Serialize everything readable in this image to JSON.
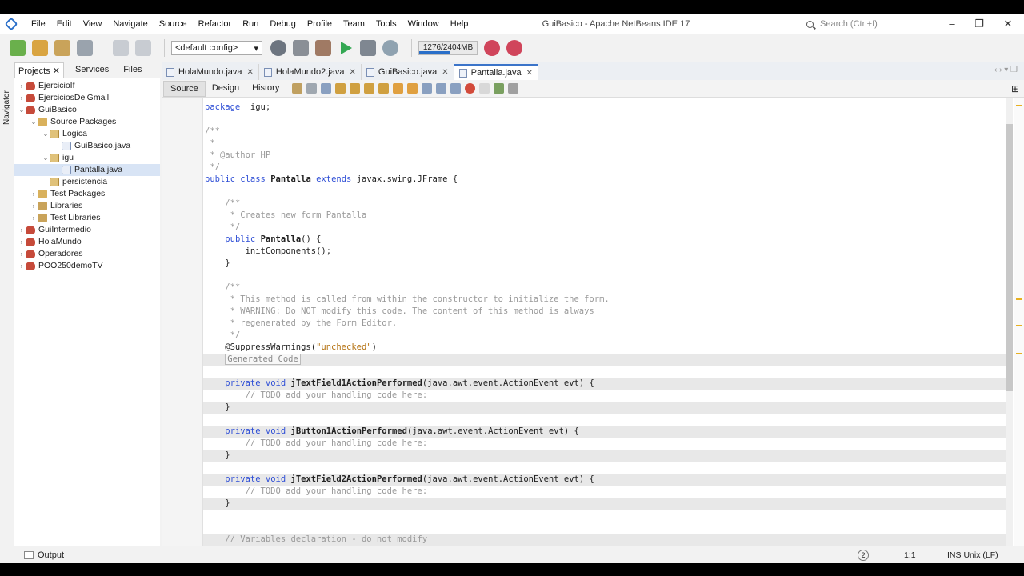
{
  "window": {
    "title": "GuiBasico - Apache NetBeans IDE 17",
    "search_placeholder": "Search (Ctrl+I)"
  },
  "menu": [
    "File",
    "Edit",
    "View",
    "Navigate",
    "Source",
    "Refactor",
    "Run",
    "Debug",
    "Profile",
    "Team",
    "Tools",
    "Window",
    "Help"
  ],
  "toolbar": {
    "config": "<default config>",
    "memory": "1276/2404MB",
    "memory_used_fraction": 0.53
  },
  "projects_panel": {
    "tabs": [
      "Projects",
      "Services",
      "Files"
    ],
    "navigator_label": "Navigator",
    "tree": [
      {
        "label": "EjercicioIf",
        "level": 0,
        "icon": "project-icon",
        "twisty": "collapsed"
      },
      {
        "label": "EjerciciosDelGmail",
        "level": 0,
        "icon": "project-icon",
        "twisty": "collapsed"
      },
      {
        "label": "GuiBasico",
        "level": 0,
        "icon": "project-icon",
        "twisty": "expanded"
      },
      {
        "label": "Source Packages",
        "level": 1,
        "icon": "source-packages-icon",
        "twisty": "expanded"
      },
      {
        "label": "Logica",
        "level": 2,
        "icon": "package-icon",
        "twisty": "expanded"
      },
      {
        "label": "GuiBasico.java",
        "level": 3,
        "icon": "java-file-icon",
        "twisty": ""
      },
      {
        "label": "igu",
        "level": 2,
        "icon": "package-icon",
        "twisty": "expanded"
      },
      {
        "label": "Pantalla.java",
        "level": 3,
        "icon": "java-file-icon",
        "twisty": "",
        "selected": true
      },
      {
        "label": "persistencia",
        "level": 2,
        "icon": "package-icon",
        "twisty": ""
      },
      {
        "label": "Test Packages",
        "level": 1,
        "icon": "source-packages-icon",
        "twisty": "collapsed"
      },
      {
        "label": "Libraries",
        "level": 1,
        "icon": "library-icon",
        "twisty": "collapsed"
      },
      {
        "label": "Test Libraries",
        "level": 1,
        "icon": "library-icon",
        "twisty": "collapsed"
      },
      {
        "label": "GuiIntermedio",
        "level": 0,
        "icon": "project-icon",
        "twisty": "collapsed"
      },
      {
        "label": "HolaMundo",
        "level": 0,
        "icon": "project-icon",
        "twisty": "collapsed"
      },
      {
        "label": "Operadores",
        "level": 0,
        "icon": "project-icon",
        "twisty": "collapsed"
      },
      {
        "label": "POO250demoTV",
        "level": 0,
        "icon": "project-icon",
        "twisty": "collapsed"
      }
    ]
  },
  "editor": {
    "tabs": [
      {
        "label": "HolaMundo.java",
        "active": false
      },
      {
        "label": "HolaMundo2.java",
        "active": false
      },
      {
        "label": "GuiBasico.java",
        "active": false
      },
      {
        "label": "Pantalla.java",
        "active": true
      }
    ],
    "views": [
      "Source",
      "Design",
      "History"
    ],
    "lines": [
      {
        "n": "5",
        "parts": [
          [
            "kw",
            "package"
          ],
          [
            "",
            "  igu;"
          ]
        ]
      },
      {
        "n": "6",
        "parts": []
      },
      {
        "n": "7",
        "fold": "-",
        "parts": [
          [
            "cm",
            "/**"
          ]
        ]
      },
      {
        "n": "8",
        "parts": [
          [
            "cm",
            " *"
          ]
        ]
      },
      {
        "n": "9",
        "parts": [
          [
            "cm",
            " * @author HP"
          ]
        ]
      },
      {
        "n": "10",
        "parts": [
          [
            "cm",
            " */"
          ]
        ]
      },
      {
        "n": "11",
        "parts": [
          [
            "kw",
            "public"
          ],
          [
            "",
            " "
          ],
          [
            "kw",
            "class"
          ],
          [
            "",
            " "
          ],
          [
            "bold",
            "Pantalla"
          ],
          [
            "",
            " "
          ],
          [
            "kw",
            "extends"
          ],
          [
            "",
            " javax.swing.JFrame {"
          ]
        ]
      },
      {
        "n": "12",
        "parts": []
      },
      {
        "n": "13",
        "fold": "-",
        "parts": [
          [
            "",
            "    "
          ],
          [
            "cm",
            "/**"
          ]
        ]
      },
      {
        "n": "14",
        "parts": [
          [
            "cm",
            "     * Creates new form Pantalla"
          ]
        ]
      },
      {
        "n": "15",
        "parts": [
          [
            "cm",
            "     */"
          ]
        ]
      },
      {
        "n": "16",
        "fold": "-",
        "parts": [
          [
            "",
            "    "
          ],
          [
            "kw",
            "public"
          ],
          [
            "",
            " "
          ],
          [
            "bold",
            "Pantalla"
          ],
          [
            "",
            "() {"
          ]
        ]
      },
      {
        "n": "17",
        "parts": [
          [
            "",
            "        initComponents();"
          ]
        ]
      },
      {
        "n": "18",
        "parts": [
          [
            "",
            "    }"
          ]
        ]
      },
      {
        "n": "19",
        "parts": []
      },
      {
        "n": "20",
        "fold": "-",
        "parts": [
          [
            "",
            "    "
          ],
          [
            "cm",
            "/**"
          ]
        ]
      },
      {
        "n": "21",
        "parts": [
          [
            "cm",
            "     * This method is called from within the constructor to initialize the form."
          ]
        ]
      },
      {
        "n": "22",
        "parts": [
          [
            "cm",
            "     * WARNING: Do NOT modify this code. The content of this method is always"
          ]
        ]
      },
      {
        "n": "23",
        "parts": [
          [
            "cm",
            "     * regenerated by the Form Editor."
          ]
        ]
      },
      {
        "n": "24",
        "parts": [
          [
            "cm",
            "     */"
          ]
        ]
      },
      {
        "n": "25",
        "parts": [
          [
            "",
            "    @SuppressWarnings("
          ],
          [
            "str",
            "\"unchecked\""
          ],
          [
            "",
            ")"
          ]
        ]
      },
      {
        "n": "26",
        "fold": "+",
        "guarded": true,
        "parts": [
          [
            "",
            "    "
          ],
          [
            "collapsed",
            "Generated Code"
          ]
        ]
      },
      {
        "n": "104",
        "parts": []
      },
      {
        "n": "105",
        "fold": "-",
        "hint": true,
        "guarded": true,
        "parts": [
          [
            "",
            "    "
          ],
          [
            "kw",
            "private"
          ],
          [
            "",
            " "
          ],
          [
            "kw",
            "void"
          ],
          [
            "",
            " "
          ],
          [
            "bold",
            "jTextField1ActionPerformed"
          ],
          [
            "",
            "(java.awt.event.ActionEvent evt) {"
          ]
        ]
      },
      {
        "n": "106",
        "parts": [
          [
            "cm",
            "        // TODO add your handling code here:"
          ]
        ]
      },
      {
        "n": "107",
        "guarded": true,
        "parts": [
          [
            "",
            "    }"
          ]
        ]
      },
      {
        "n": "108",
        "parts": []
      },
      {
        "n": "110",
        "fold": "-",
        "hint": true,
        "guarded": true,
        "parts": [
          [
            "",
            "    "
          ],
          [
            "kw",
            "private"
          ],
          [
            "",
            " "
          ],
          [
            "kw",
            "void"
          ],
          [
            "",
            " "
          ],
          [
            "bold",
            "jButton1ActionPerformed"
          ],
          [
            "",
            "(java.awt.event.ActionEvent evt) {"
          ]
        ]
      },
      {
        "n": "110",
        "parts": [
          [
            "cm",
            "        // TODO add your handling code here:"
          ]
        ]
      },
      {
        "n": "111",
        "guarded": true,
        "parts": [
          [
            "",
            "    }"
          ]
        ]
      },
      {
        "n": "112",
        "parts": []
      },
      {
        "n": "113",
        "fold": "-",
        "hint": true,
        "guarded": true,
        "parts": [
          [
            "",
            "    "
          ],
          [
            "kw",
            "private"
          ],
          [
            "",
            " "
          ],
          [
            "kw",
            "void"
          ],
          [
            "",
            " "
          ],
          [
            "bold",
            "jTextField2ActionPerformed"
          ],
          [
            "",
            "(java.awt.event.ActionEvent evt) {"
          ]
        ]
      },
      {
        "n": "114",
        "parts": [
          [
            "cm",
            "        // TODO add your handling code here:"
          ]
        ]
      },
      {
        "n": "115",
        "guarded": true,
        "parts": [
          [
            "",
            "    }"
          ]
        ]
      },
      {
        "n": "116",
        "parts": []
      },
      {
        "n": "117",
        "parts": []
      },
      {
        "n": "118",
        "guarded": true,
        "parts": [
          [
            "cm",
            "    // Variables declaration - do not modify"
          ]
        ]
      }
    ]
  },
  "statusbar": {
    "output_label": "Output",
    "caret_position": "1:1",
    "mode": "INS",
    "line_endings": "Unix (LF)"
  }
}
